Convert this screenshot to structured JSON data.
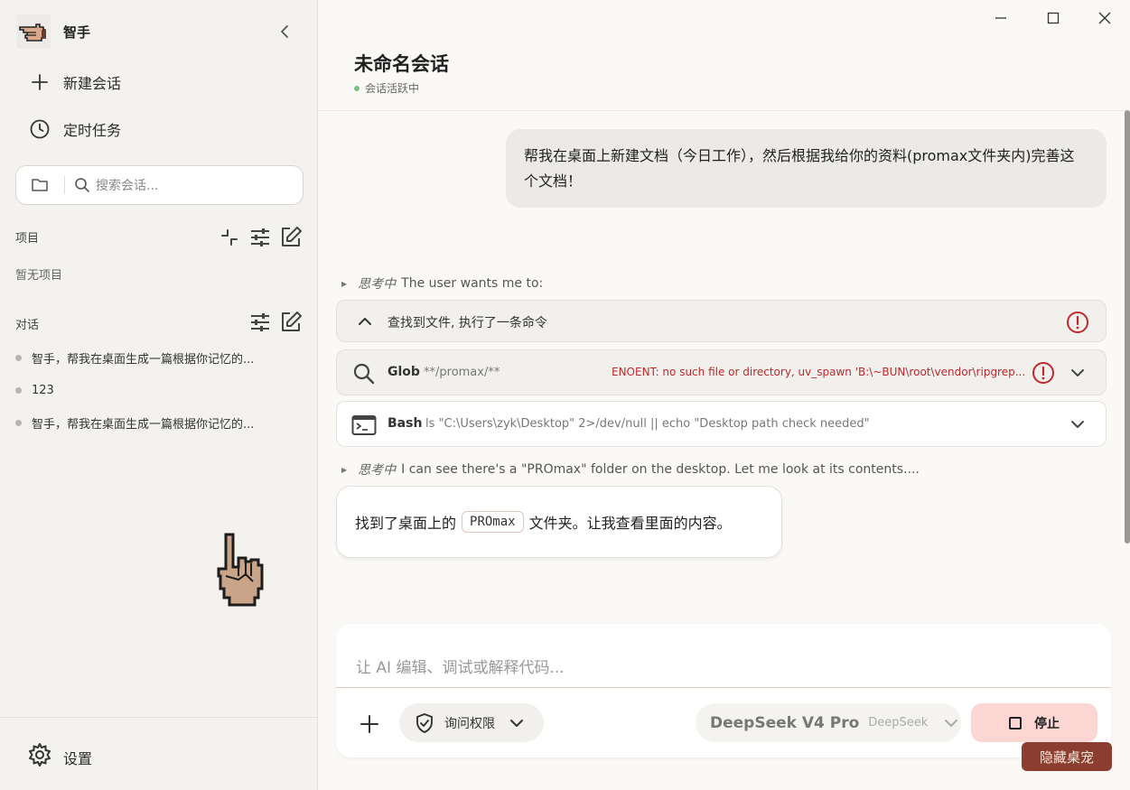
{
  "app": {
    "name": "智手"
  },
  "nav": {
    "new_chat": "新建会话",
    "scheduled": "定时任务"
  },
  "search": {
    "placeholder": "搜索会话..."
  },
  "projects": {
    "title": "项目",
    "empty": "暂无项目"
  },
  "conversations": {
    "title": "对话",
    "items": [
      {
        "label": "智手，帮我在桌面生成一篇根据你记忆的..."
      },
      {
        "label": "123"
      },
      {
        "label": "智手，帮我在桌面生成一篇根据你记忆的..."
      }
    ]
  },
  "settings": {
    "label": "设置"
  },
  "chat": {
    "title": "未命名会话",
    "status": "会话活跃中",
    "user_message": "帮我在桌面上新建文档（今日工作），然后根据我给你的资料(promax文件夹内)完善这个文档！",
    "thinking": [
      {
        "label": "思考中",
        "text": "The user wants me to:"
      },
      {
        "label": "思考中",
        "text": "I can see there's a \"PROmax\" folder on the desktop. Let me look at its contents...."
      }
    ],
    "tool_group": {
      "summary": "查找到文件, 执行了一条命令"
    },
    "tools": [
      {
        "name": "Glob",
        "arg": "**/promax/**",
        "error": "ENOENT: no such file or directory, uv_spawn 'B:\\~BUN\\root\\vendor\\ripgrep..."
      },
      {
        "name": "Bash",
        "arg": "ls \"C:\\Users\\zyk\\Desktop\" 2>/dev/null || echo \"Desktop path check needed\""
      }
    ],
    "assistant_message": {
      "before": "找到了桌面上的",
      "code": "PROmax",
      "after": "文件夹。让我查看里面的内容。"
    }
  },
  "composer": {
    "placeholder": "让 AI 编辑、调试或解释代码...",
    "permission": "询问权限",
    "model": "DeepSeek V4 Pro",
    "provider": "DeepSeek",
    "stop": "停止"
  },
  "pet": {
    "hide_label": "隐藏桌宠"
  },
  "colors": {
    "accent": "#8b3e2f",
    "stop_bg": "#fbd6d3",
    "error": "#c0282d",
    "active": "#7cc07f"
  }
}
